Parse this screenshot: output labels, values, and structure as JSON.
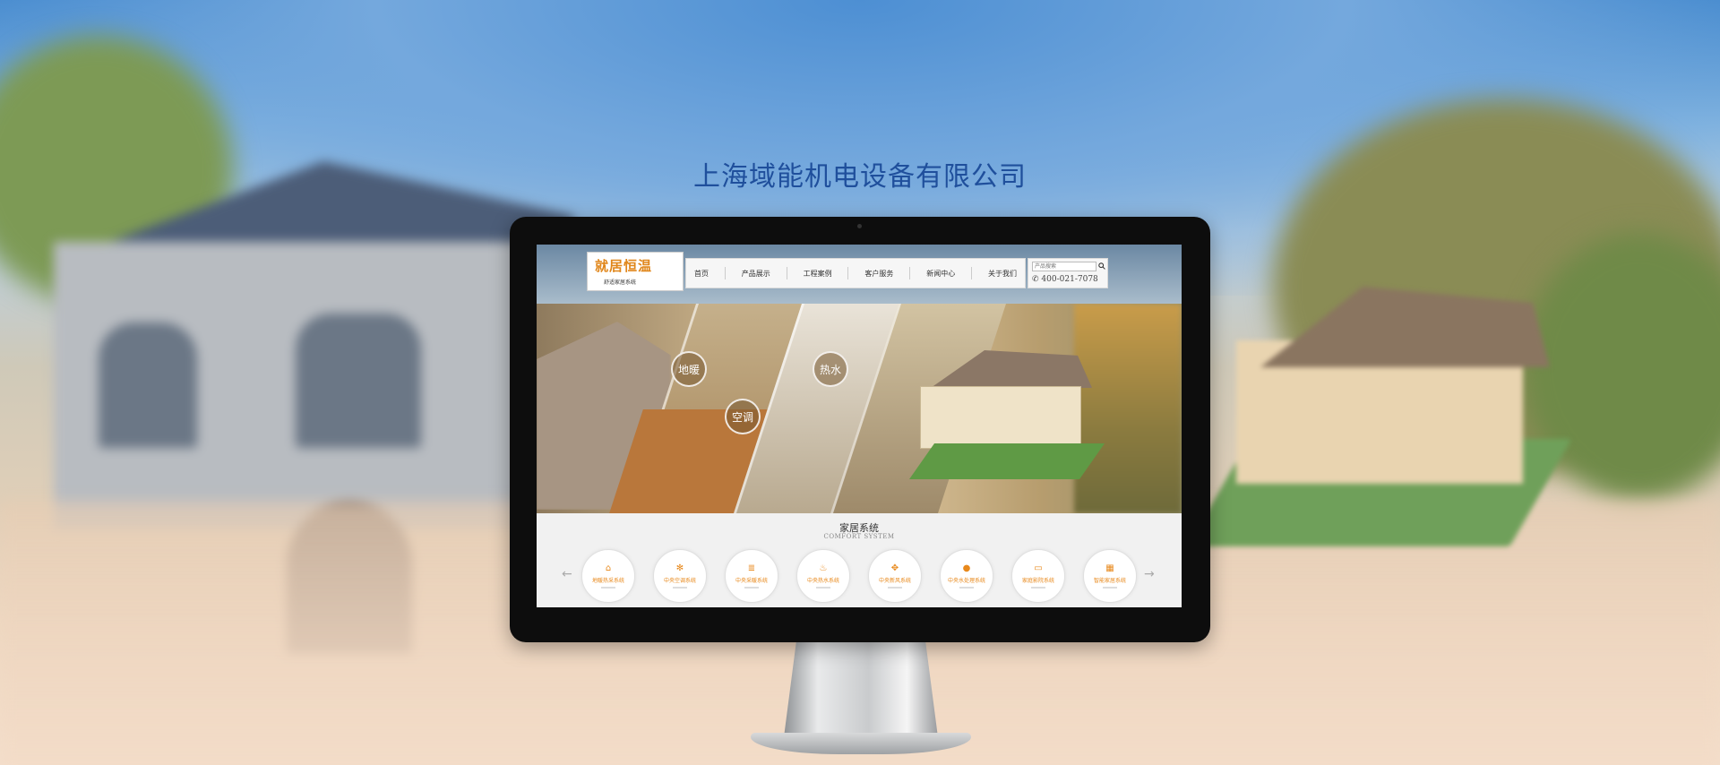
{
  "headline": "上海域能机电设备有限公司",
  "site": {
    "logo": {
      "text": "就居恒温",
      "subtitle": "舒适家居系统"
    },
    "nav": [
      "首页",
      "产品展示",
      "工程案例",
      "客户服务",
      "新闻中心",
      "关于我们"
    ],
    "search": {
      "placeholder": "产品搜索"
    },
    "hotline": "400-021-7078",
    "banner_labels": [
      "地暖",
      "热水",
      "空调"
    ],
    "section": {
      "title": "家居系统",
      "subtitle": "COMFORT SYSTEM"
    },
    "systems": [
      {
        "label": "地暖热采系统",
        "icon": "house-icon"
      },
      {
        "label": "中央空调系统",
        "icon": "snowflake-icon"
      },
      {
        "label": "中央采暖系统",
        "icon": "radiator-icon"
      },
      {
        "label": "中央热水系统",
        "icon": "water-heater-icon"
      },
      {
        "label": "中央新风系统",
        "icon": "fan-icon"
      },
      {
        "label": "中央水处理系统",
        "icon": "water-drop-icon"
      },
      {
        "label": "家庭影院系统",
        "icon": "screen-icon"
      },
      {
        "label": "智能家居系统",
        "icon": "smart-home-icon"
      }
    ]
  },
  "colors": {
    "headline": "#1f4f9c",
    "accent": "#e8891c",
    "bezel": "#0d0d0d"
  }
}
